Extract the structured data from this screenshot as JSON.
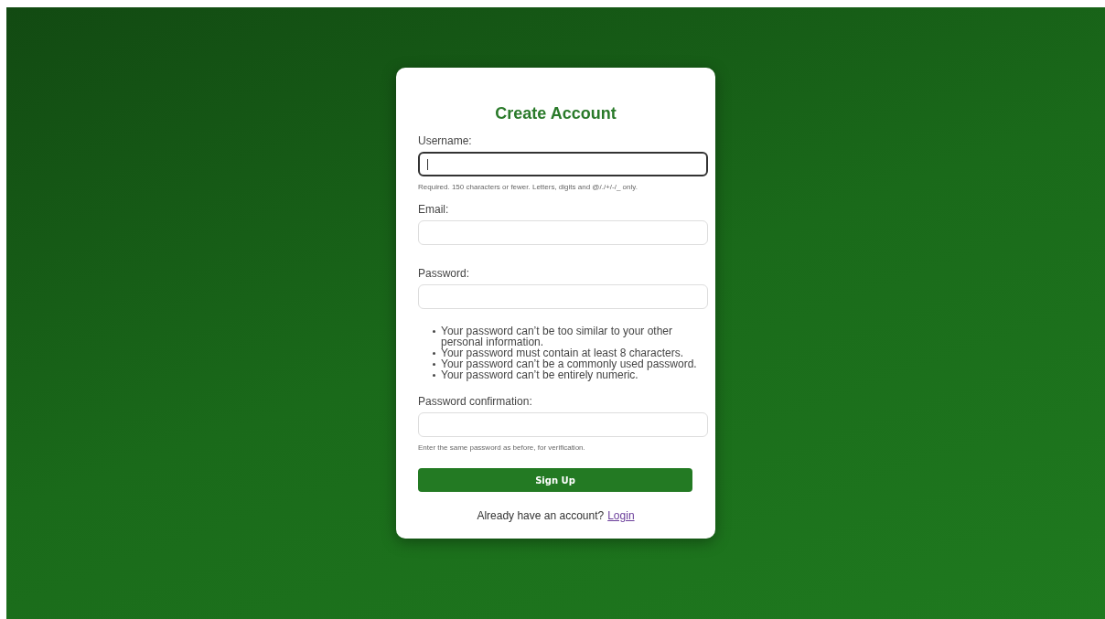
{
  "title": "Create Account",
  "fields": [
    {
      "label": "Username:",
      "focused": true,
      "help": "Required. 150 characters or fewer. Letters, digits and @/./+/-/_ only."
    },
    {
      "label": "Email:",
      "focused": false
    },
    {
      "label": "Password:",
      "focused": false,
      "help_items": [
        "Your password can’t be too similar to your other personal information.",
        "Your password must contain at least 8 characters.",
        "Your password can’t be a commonly used password.",
        "Your password can’t be entirely numeric."
      ]
    },
    {
      "label": "Password confirmation:",
      "focused": false,
      "help": "Enter the same password as before, for verification."
    }
  ],
  "submit": "Sign Up",
  "footer": {
    "text": "Already have an account?",
    "link": "Login"
  }
}
